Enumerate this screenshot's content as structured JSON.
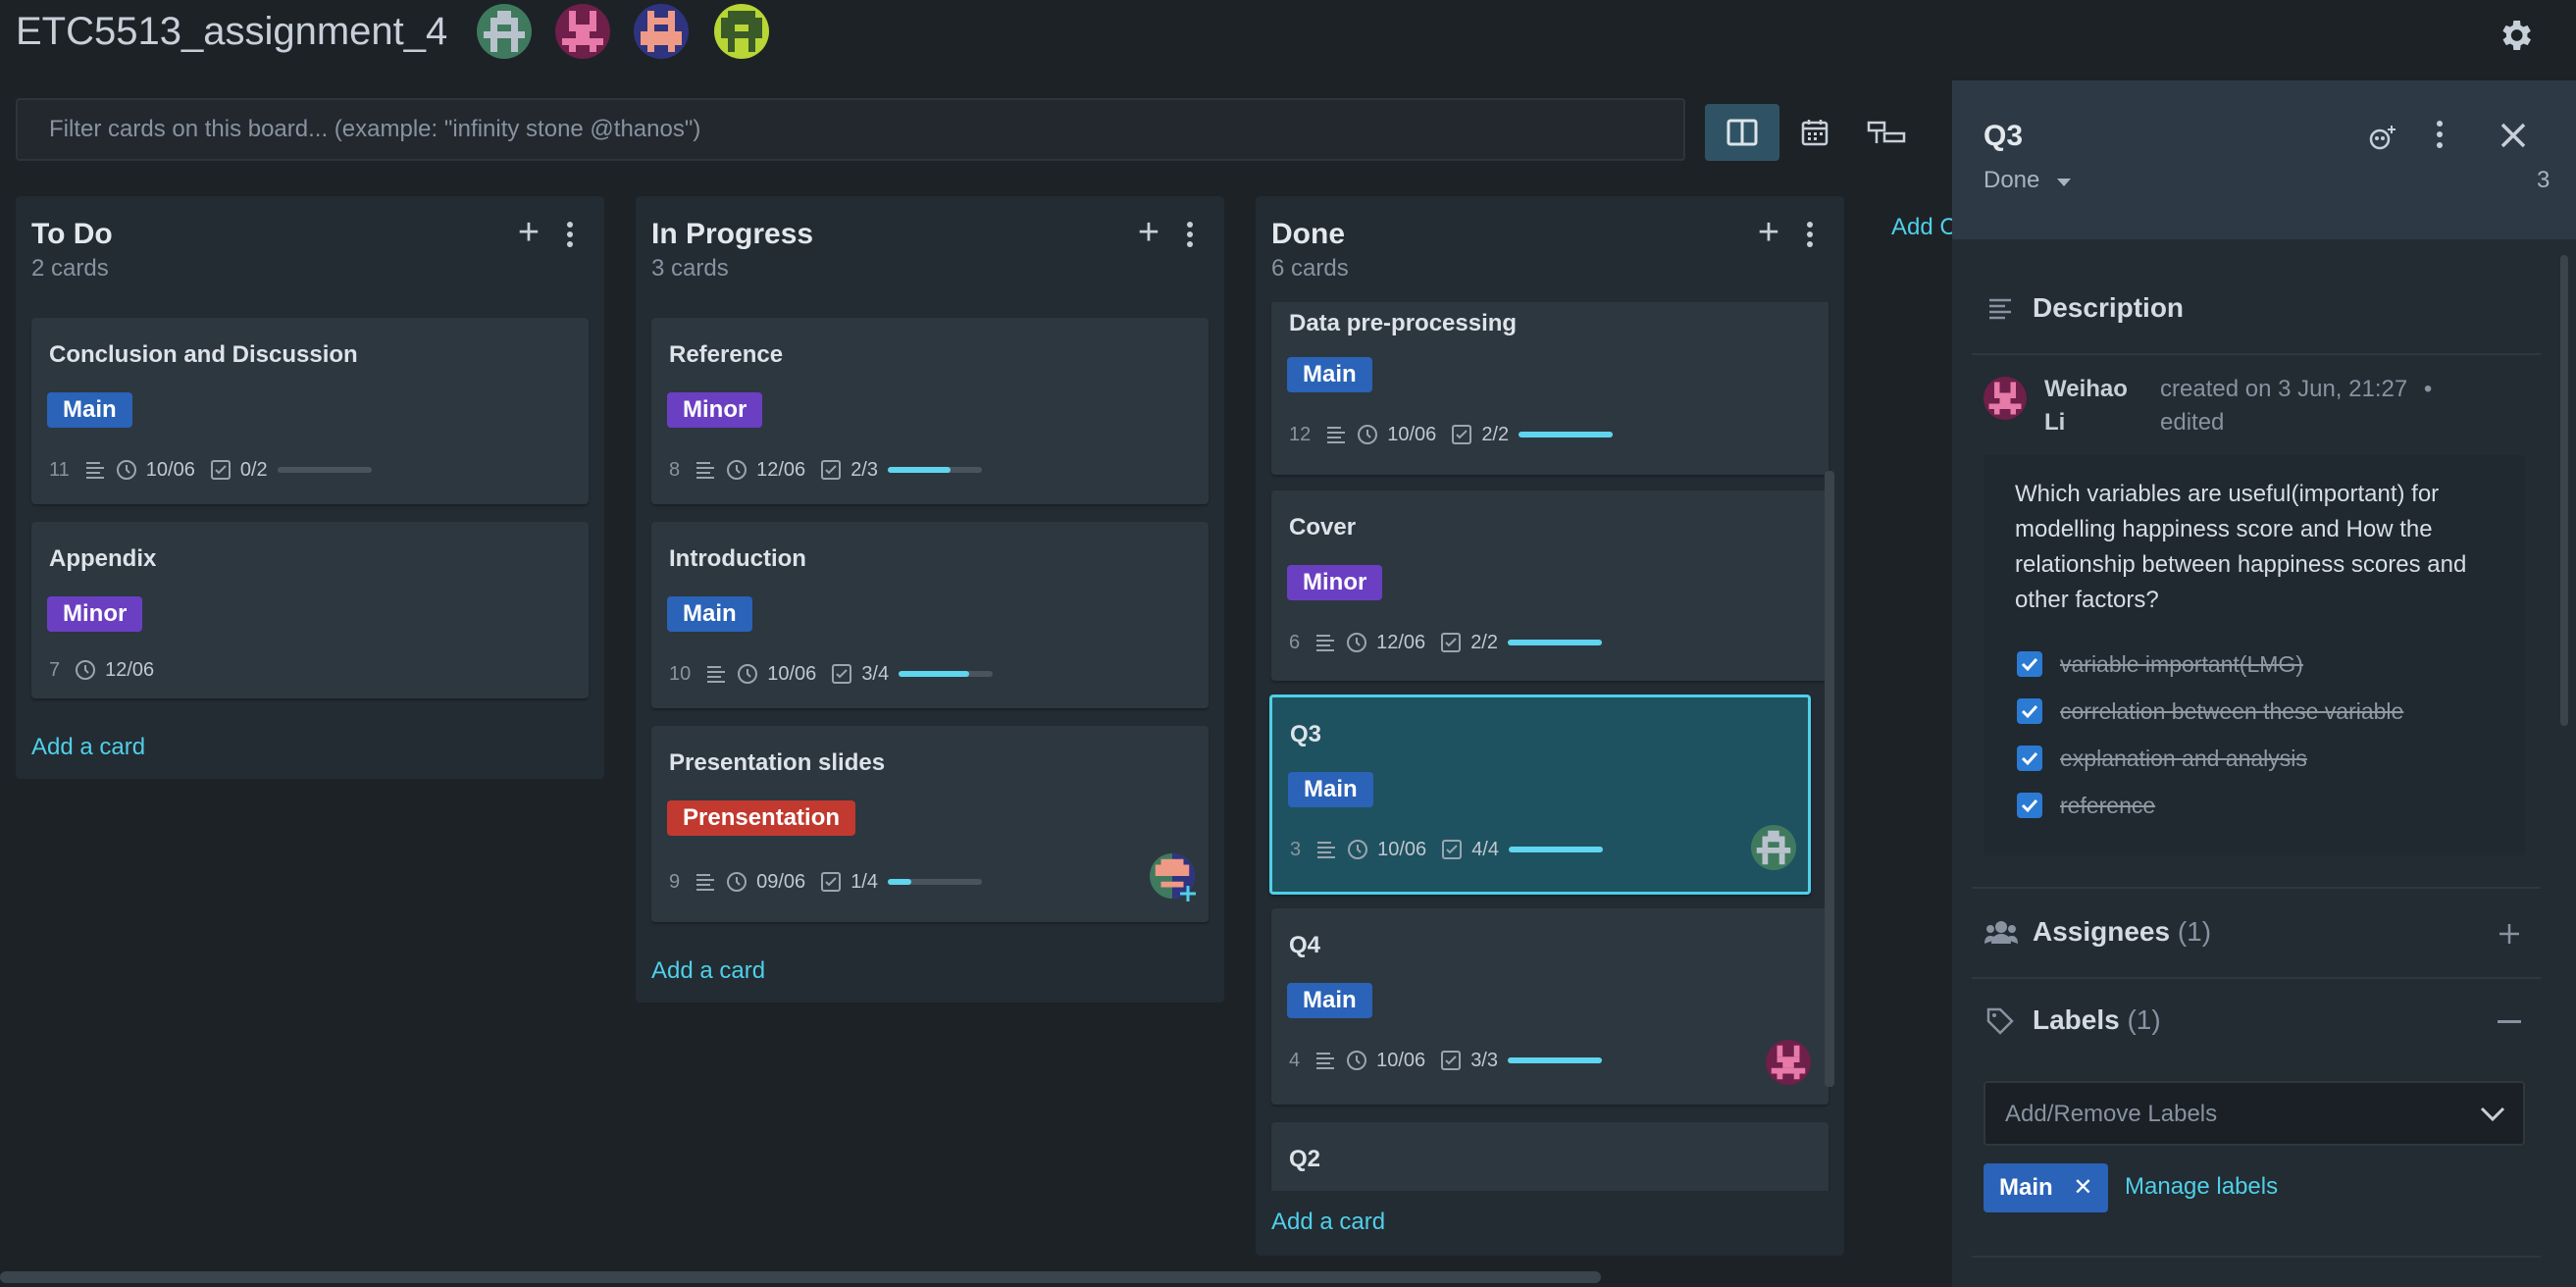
{
  "board": {
    "title": "ETC5513_assignment_4",
    "filter_placeholder": "Filter cards on this board... (example: \"infinity stone @thanos\")",
    "add_column": "Add C"
  },
  "columns": [
    {
      "title": "To Do",
      "count": "2 cards",
      "add_card": "Add a card",
      "cards": [
        {
          "title": "Conclusion and Discussion",
          "label": "Main",
          "id": "11",
          "date": "10/06",
          "checks": "0/2",
          "progress": 0
        },
        {
          "title": "Appendix",
          "label": "Minor",
          "id": "7",
          "date": "12/06"
        }
      ]
    },
    {
      "title": "In Progress",
      "count": "3 cards",
      "add_card": "Add a card",
      "cards": [
        {
          "title": "Reference",
          "label": "Minor",
          "id": "8",
          "date": "12/06",
          "checks": "2/3",
          "progress": 0.67
        },
        {
          "title": "Introduction",
          "label": "Main",
          "id": "10",
          "date": "10/06",
          "checks": "3/4",
          "progress": 0.75
        },
        {
          "title": "Presentation slides",
          "label": "Prensentation",
          "id": "9",
          "date": "09/06",
          "checks": "1/4",
          "progress": 0.25
        }
      ]
    },
    {
      "title": "Done",
      "count": "6 cards",
      "add_card": "Add a card",
      "cards": [
        {
          "title": "Data pre-processing",
          "label": "Main",
          "id": "12",
          "date": "10/06",
          "checks": "2/2",
          "progress": 1
        },
        {
          "title": "Cover",
          "label": "Minor",
          "id": "6",
          "date": "12/06",
          "checks": "2/2",
          "progress": 1
        },
        {
          "title": "Q3",
          "label": "Main",
          "id": "3",
          "date": "10/06",
          "checks": "4/4",
          "progress": 1
        },
        {
          "title": "Q4",
          "label": "Main",
          "id": "4",
          "date": "10/06",
          "checks": "3/3",
          "progress": 1
        },
        {
          "title": "Q2"
        }
      ]
    }
  ],
  "panel": {
    "title": "Q3",
    "status": "Done",
    "number": "3",
    "description_header": "Description",
    "author_first": "Weihao",
    "author_last": "Li",
    "created": "created on 3 Jun, 21:27",
    "bullet": "•",
    "edited": "edited",
    "description": "Which variables are useful(important) for modelling happiness score and How the relationship between happiness scores and other factors?",
    "checklist": [
      "variable important(LMG)",
      "correlation between these variable",
      "explanation and analysis",
      "reference"
    ],
    "assignees_header": "Assignees",
    "assignees_count": "(1)",
    "labels_header": "Labels",
    "labels_count": "(1)",
    "labels_placeholder": "Add/Remove Labels",
    "label_chip": "Main",
    "chip_remove": "✕",
    "manage_labels": "Manage labels"
  },
  "colors": {
    "main": "#2a63b8",
    "minor": "#6b3fc2",
    "presentation": "#c2392f",
    "accent": "#4fd0e8"
  }
}
